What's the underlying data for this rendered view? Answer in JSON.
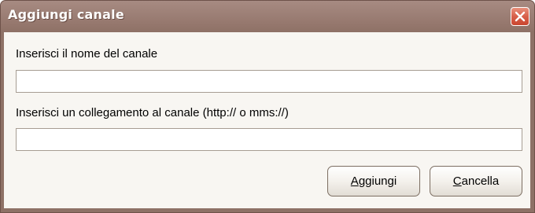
{
  "dialog": {
    "title": "Aggiungi canale",
    "close_icon": "close-x-icon"
  },
  "form": {
    "name_label": "Inserisci il nome del canale",
    "name_value": "",
    "url_label": "Inserisci un collegamento al canale (http:// o mms://)",
    "url_value": ""
  },
  "buttons": {
    "add": {
      "hotkey": "A",
      "rest": "ggiungi"
    },
    "cancel": {
      "hotkey": "C",
      "rest": "ancella"
    }
  },
  "colors": {
    "frame": "#95776d",
    "client_bg": "#f8f6f2",
    "close_button": "#d8604a"
  }
}
